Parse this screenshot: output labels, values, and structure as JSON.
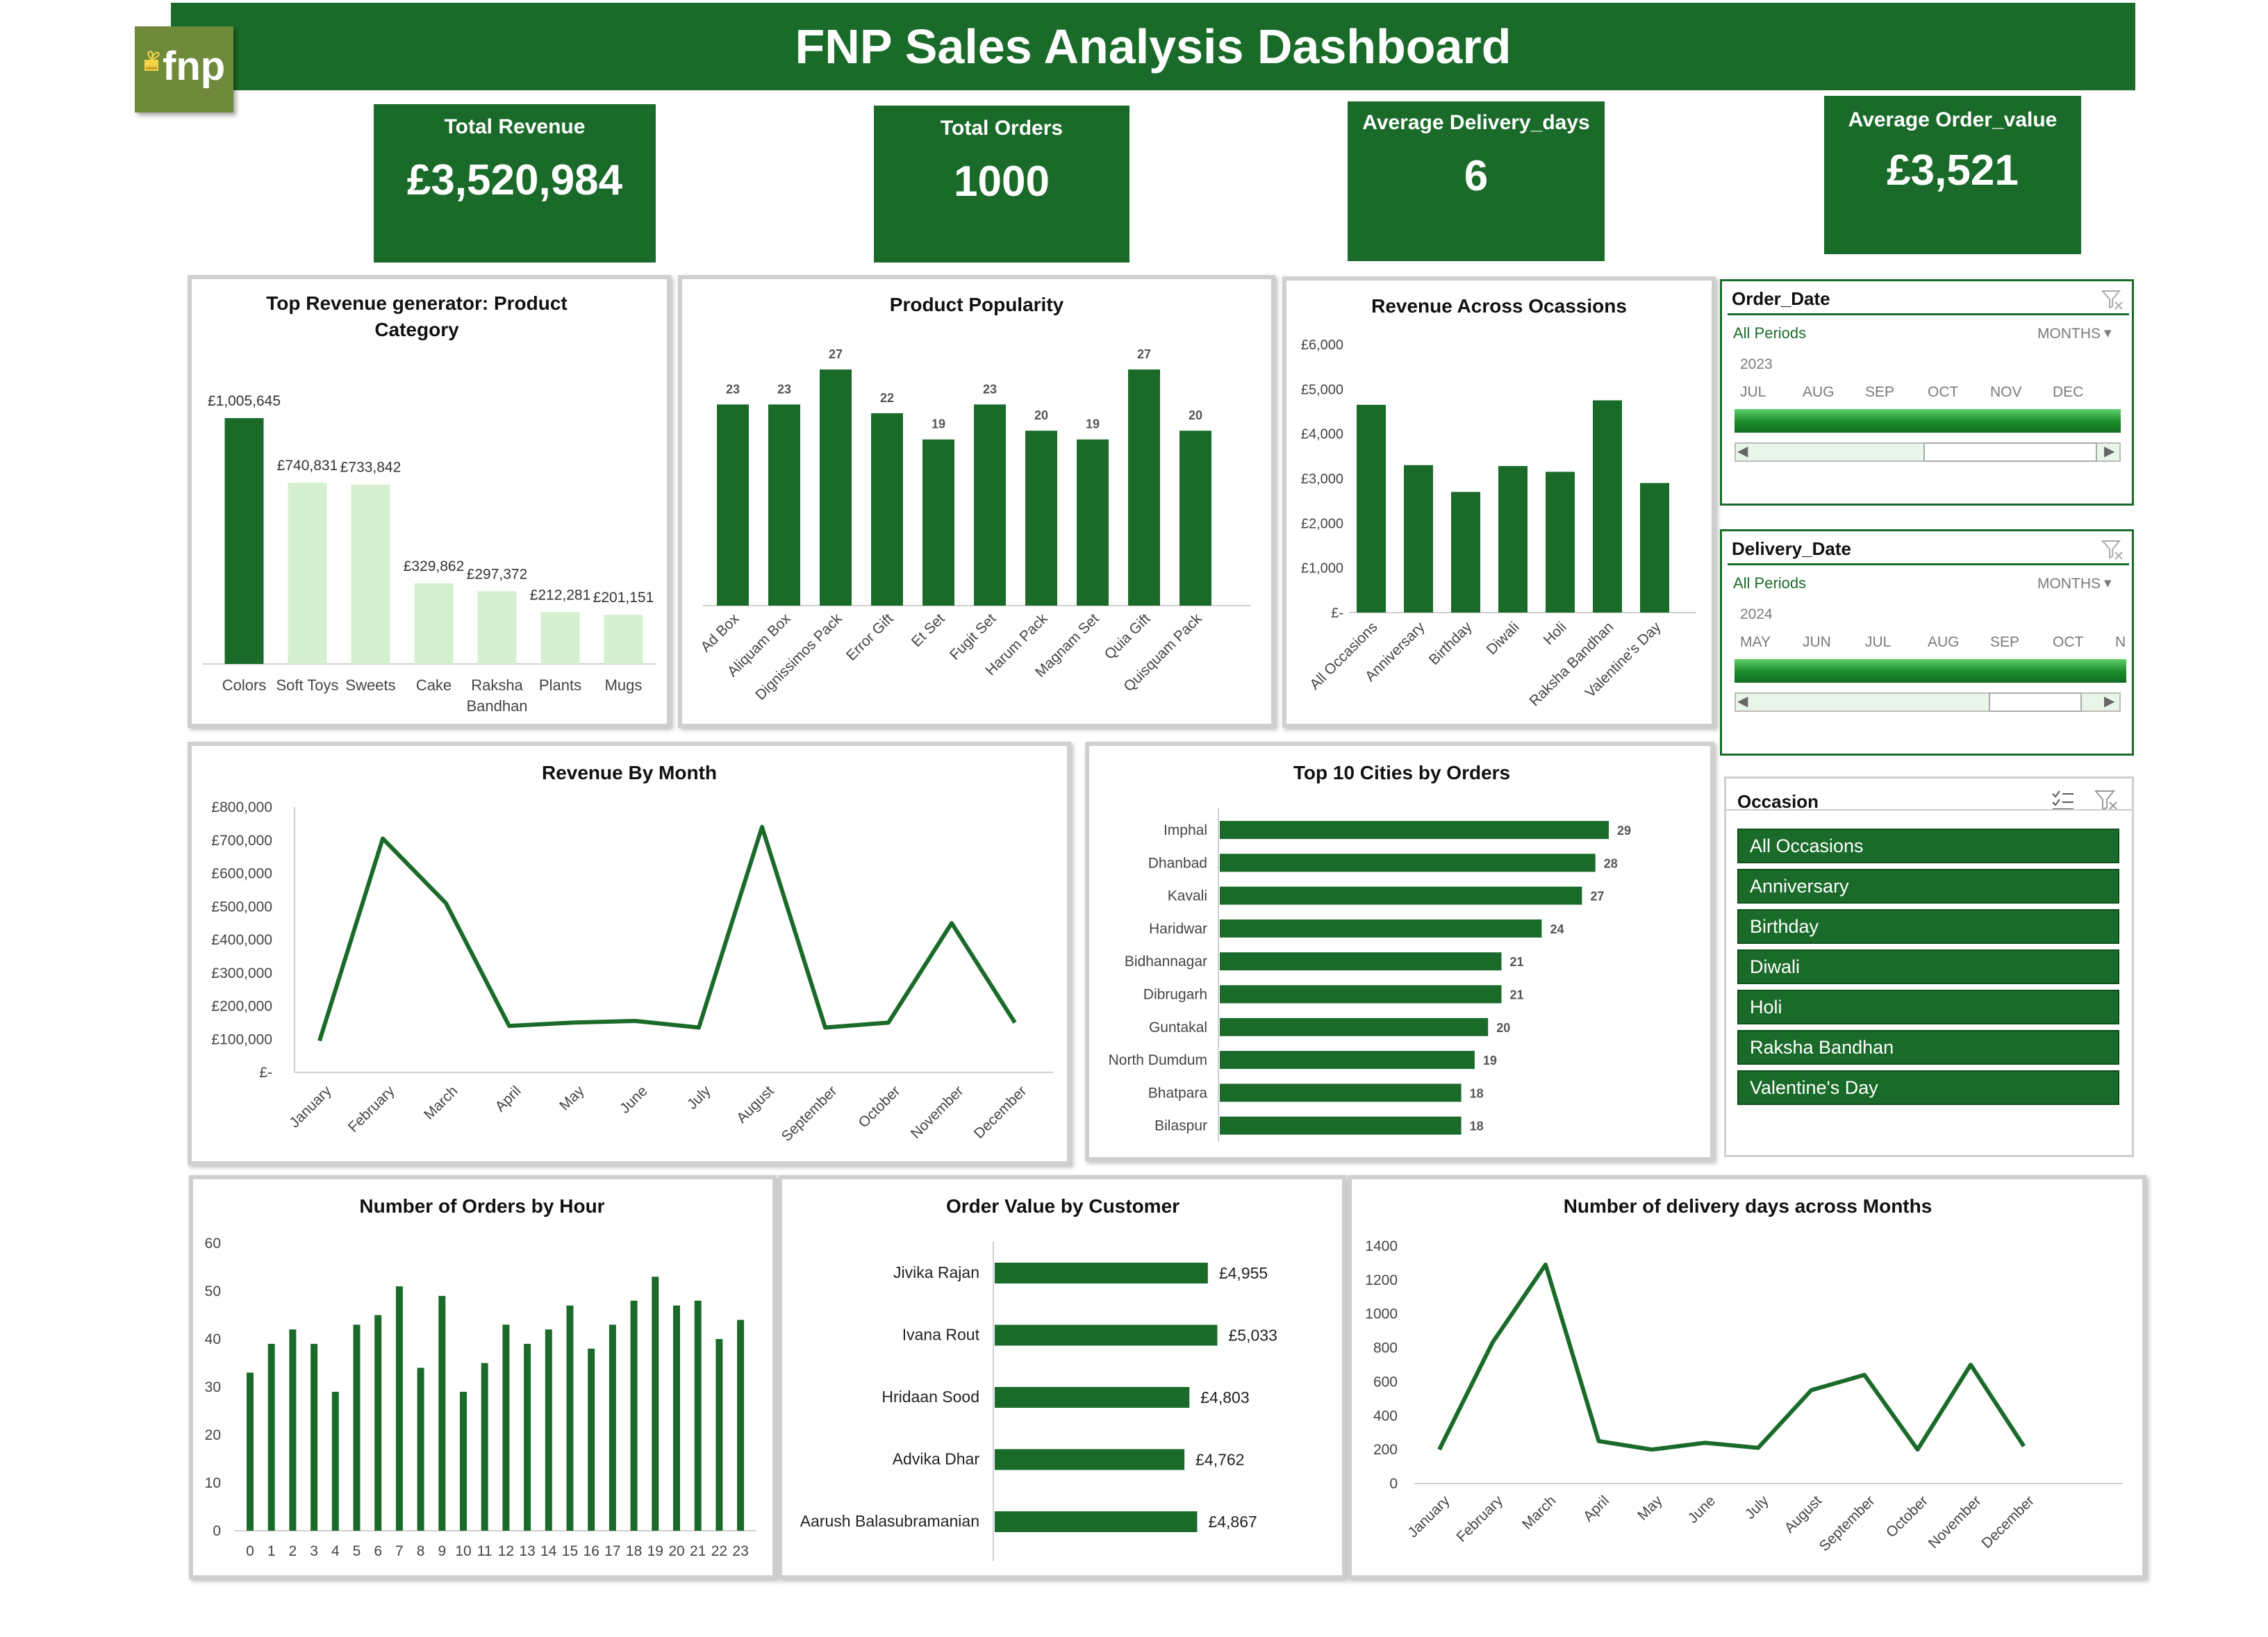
{
  "header": {
    "title": "FNP Sales Analysis Dashboard",
    "logo_text": "fnp"
  },
  "kpis": [
    {
      "label": "Total Revenue",
      "value": "£3,520,984"
    },
    {
      "label": "Total Orders",
      "value": "1000"
    },
    {
      "label": "Average Delivery_days",
      "value": "6"
    },
    {
      "label": "Average Order_value",
      "value": "£3,521"
    }
  ],
  "slicers": {
    "order_date": {
      "title": "Order_Date",
      "period": "All Periods",
      "level": "MONTHS",
      "year": "2023",
      "months": [
        "JUL",
        "AUG",
        "SEP",
        "OCT",
        "NOV",
        "DEC"
      ]
    },
    "delivery_date": {
      "title": "Delivery_Date",
      "period": "All Periods",
      "level": "MONTHS",
      "year": "2024",
      "months": [
        "MAY",
        "JUN",
        "JUL",
        "AUG",
        "SEP",
        "OCT",
        "N"
      ]
    },
    "occasion": {
      "title": "Occasion",
      "items": [
        "All Occasions",
        "Anniversary",
        "Birthday",
        "Diwali",
        "Holi",
        "Raksha Bandhan",
        "Valentine's Day"
      ]
    }
  },
  "colors": {
    "dark_green": "#1a6b2a",
    "light_green": "#d4f0cf",
    "header_green": "#1a6b2a"
  },
  "chart_data": [
    {
      "id": "category",
      "type": "bar",
      "title": "Top Revenue generator: Product Category",
      "categories": [
        "Colors",
        "Soft Toys",
        "Sweets",
        "Cake",
        "Raksha Bandhan",
        "Plants",
        "Mugs"
      ],
      "values": [
        1005645,
        740831,
        733842,
        329862,
        297372,
        212281,
        201151
      ],
      "value_labels": [
        "£1,005,645",
        "£740,831",
        "£733,842",
        "£329,862",
        "£297,372",
        "£212,281",
        "£201,151"
      ],
      "highlight": [
        true,
        false,
        false,
        false,
        false,
        false,
        false
      ]
    },
    {
      "id": "popularity",
      "type": "bar",
      "title": "Product Popularity",
      "categories": [
        "Ad Box",
        "Aliquam Box",
        "Dignissimos Pack",
        "Error Gift",
        "Et Set",
        "Fugit Set",
        "Harum Pack",
        "Magnam Set",
        "Quia Gift",
        "Quisquam Pack"
      ],
      "values": [
        23,
        23,
        27,
        22,
        19,
        23,
        20,
        19,
        27,
        20
      ]
    },
    {
      "id": "occasions",
      "type": "bar",
      "title": "Revenue Across Ocassions",
      "categories": [
        "All Occasions",
        "Anniversary",
        "Birthday",
        "Diwali",
        "Holi",
        "Raksha Bandhan",
        "Valentine's Day"
      ],
      "values": [
        4650,
        3300,
        2700,
        3280,
        3150,
        4750,
        2900
      ],
      "ylim": [
        0,
        6000
      ],
      "yticks": [
        "£-",
        "£1,000",
        "£2,000",
        "£3,000",
        "£4,000",
        "£5,000",
        "£6,000"
      ]
    },
    {
      "id": "rev_month",
      "type": "line",
      "title": "Revenue By Month",
      "categories": [
        "January",
        "February",
        "March",
        "April",
        "May",
        "June",
        "July",
        "August",
        "September",
        "October",
        "November",
        "December"
      ],
      "values": [
        95000,
        705000,
        510000,
        140000,
        150000,
        155000,
        135000,
        740000,
        135000,
        150000,
        450000,
        150000
      ],
      "ylim": [
        0,
        800000
      ],
      "yticks": [
        "£-",
        "£100,000",
        "£200,000",
        "£300,000",
        "£400,000",
        "£500,000",
        "£600,000",
        "£700,000",
        "£800,000"
      ]
    },
    {
      "id": "cities",
      "type": "bar",
      "title": "Top 10 Cities by Orders",
      "categories": [
        "Imphal",
        "Dhanbad",
        "Kavali",
        "Haridwar",
        "Bidhannagar",
        "Dibrugarh",
        "Guntakal",
        "North Dumdum",
        "Bhatpara",
        "Bilaspur"
      ],
      "values": [
        29,
        28,
        27,
        24,
        21,
        21,
        20,
        19,
        18,
        18
      ]
    },
    {
      "id": "hours",
      "type": "bar",
      "title": "Number of Orders by Hour",
      "categories": [
        "0",
        "1",
        "2",
        "3",
        "4",
        "5",
        "6",
        "7",
        "8",
        "9",
        "10",
        "11",
        "12",
        "13",
        "14",
        "15",
        "16",
        "17",
        "18",
        "19",
        "20",
        "21",
        "22",
        "23"
      ],
      "values": [
        33,
        39,
        42,
        39,
        29,
        43,
        45,
        51,
        34,
        49,
        29,
        35,
        43,
        39,
        42,
        47,
        38,
        43,
        48,
        53,
        47,
        48,
        40,
        44
      ],
      "ylim": [
        0,
        60
      ],
      "yticks": [
        "0",
        "10",
        "20",
        "30",
        "40",
        "50",
        "60"
      ]
    },
    {
      "id": "customers",
      "type": "bar",
      "title": "Order Value by Customer",
      "categories": [
        "Jivika Rajan",
        "Ivana Rout",
        "Hridaan Sood",
        "Advika Dhar",
        "Aarush Balasubramanian"
      ],
      "values": [
        4955,
        5033,
        4803,
        4762,
        4867
      ],
      "value_labels": [
        "£4,955",
        "£5,033",
        "£4,803",
        "£4,762",
        "£4,867"
      ]
    },
    {
      "id": "delivery_days",
      "type": "line",
      "title": "Number of delivery days across Months",
      "categories": [
        "January",
        "February",
        "March",
        "April",
        "May",
        "June",
        "July",
        "August",
        "September",
        "October",
        "November",
        "December"
      ],
      "values": [
        200,
        830,
        1290,
        250,
        200,
        240,
        210,
        550,
        640,
        200,
        700,
        220
      ],
      "ylim": [
        0,
        1400
      ],
      "yticks": [
        "0",
        "200",
        "400",
        "600",
        "800",
        "1000",
        "1200",
        "1400"
      ]
    }
  ]
}
